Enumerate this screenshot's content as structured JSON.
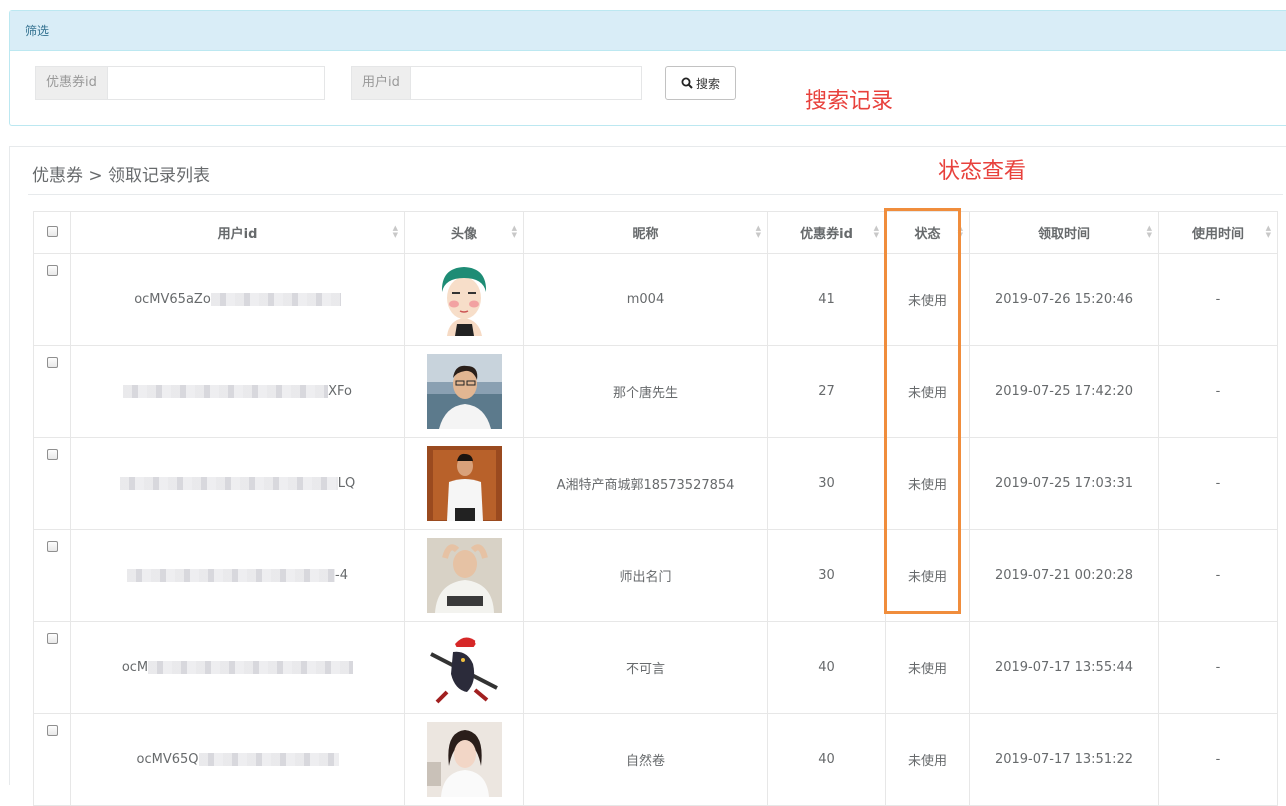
{
  "filter": {
    "heading": "筛选",
    "coupon_id_label": "优惠券id",
    "coupon_id_value": "",
    "user_id_label": "用户id",
    "user_id_value": "",
    "search_label": "搜索"
  },
  "annotations": {
    "search_note": "搜索记录",
    "status_note": "状态查看"
  },
  "breadcrumb": "优惠券 > 领取记录列表",
  "table": {
    "headers": {
      "user_id": "用户id",
      "avatar": "头像",
      "nickname": "昵称",
      "coupon_id": "优惠券id",
      "status": "状态",
      "receive_time": "领取时间",
      "use_time": "使用时间"
    },
    "rows": [
      {
        "uid_prefix": "ocMV65aZo",
        "uid_suffix": "",
        "nickname": "m004",
        "coupon_id": "41",
        "status": "未使用",
        "receive_time": "2019-07-26 15:20:46",
        "use_time": "-"
      },
      {
        "uid_prefix": "",
        "uid_suffix": "XFo",
        "nickname": "那个唐先生",
        "coupon_id": "27",
        "status": "未使用",
        "receive_time": "2019-07-25 17:42:20",
        "use_time": "-"
      },
      {
        "uid_prefix": "",
        "uid_suffix": "LQ",
        "nickname": "A湘特产商城郭18573527854",
        "coupon_id": "30",
        "status": "未使用",
        "receive_time": "2019-07-25 17:03:31",
        "use_time": "-"
      },
      {
        "uid_prefix": "",
        "uid_suffix": "-4",
        "nickname": "师出名门",
        "coupon_id": "30",
        "status": "未使用",
        "receive_time": "2019-07-21 00:20:28",
        "use_time": "-"
      },
      {
        "uid_prefix": "ocM",
        "uid_suffix": "",
        "nickname": "不可言",
        "coupon_id": "40",
        "status": "未使用",
        "receive_time": "2019-07-17 13:55:44",
        "use_time": "-"
      },
      {
        "uid_prefix": "ocMV65Q",
        "uid_suffix": "",
        "nickname": "自然卷",
        "coupon_id": "40",
        "status": "未使用",
        "receive_time": "2019-07-17 13:51:22",
        "use_time": "-"
      }
    ]
  },
  "colors": {
    "annotation": "#e8413c",
    "highlight": "#f08d3c",
    "panel_heading_bg": "#d9edf7"
  }
}
